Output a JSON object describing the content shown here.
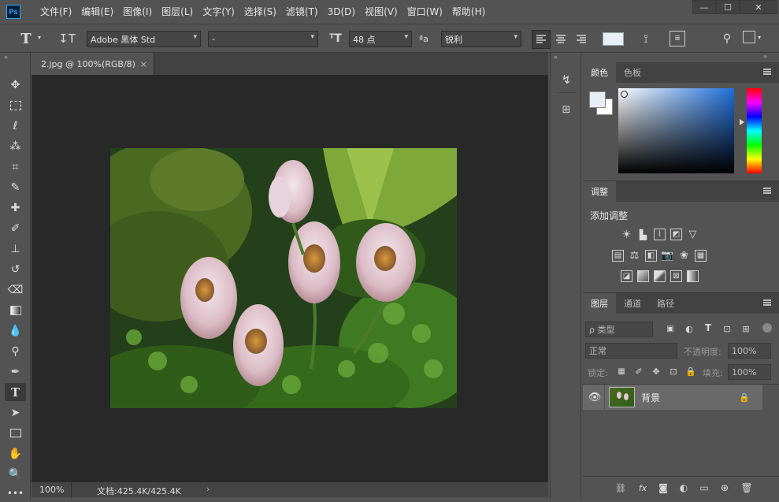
{
  "app": {
    "logo_text": "Ps"
  },
  "menu": {
    "items": [
      "文件(F)",
      "编辑(E)",
      "图像(I)",
      "图层(L)",
      "文字(Y)",
      "选择(S)",
      "滤镜(T)",
      "3D(D)",
      "视图(V)",
      "窗口(W)",
      "帮助(H)"
    ]
  },
  "window_controls": {
    "minimize": "—",
    "maximize": "☐",
    "close": "✕"
  },
  "options": {
    "font_family": "Adobe 黑体 Std",
    "font_style": "-",
    "font_size": "48 点",
    "antialias_label": "ªa",
    "antialias": "锐利"
  },
  "document": {
    "tab_title": "2.jpg @ 100%(RGB/8)",
    "tab_close": "×",
    "zoom": "100%",
    "doc_info": "文档:425.4K/425.4K",
    "status_arrow": "›"
  },
  "panels": {
    "color_tabs": [
      "颜色",
      "色板"
    ],
    "adjust_tab": "调整",
    "adjust_title": "添加调整",
    "layer_tabs": [
      "图层",
      "通道",
      "路径"
    ],
    "filter_kind": "ρ 类型",
    "blend_mode": "正常",
    "opacity_label": "不透明度:",
    "opacity_value": "100%",
    "lock_label": "锁定:",
    "fill_label": "填充:",
    "fill_value": "100%",
    "layer_name": "背景"
  },
  "colors": {
    "foreground": "#e8eef5",
    "background": "#ffffff",
    "accent_bar": "#ffffff"
  }
}
